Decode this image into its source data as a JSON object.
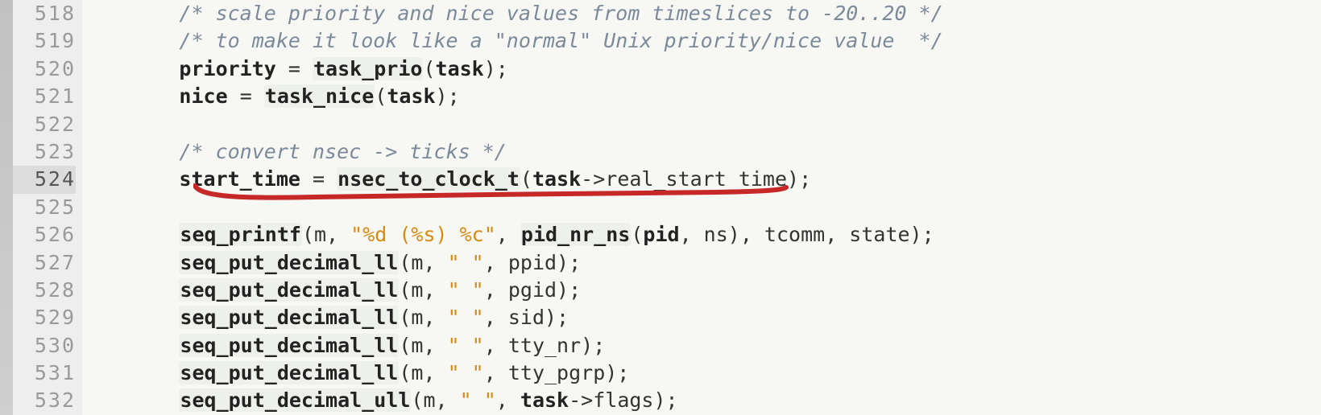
{
  "gutter": {
    "start": 518,
    "highlight": 524,
    "lines": [
      "518",
      "519",
      "520",
      "521",
      "522",
      "523",
      "524",
      "525",
      "526",
      "527",
      "528",
      "529",
      "530",
      "531",
      "532"
    ]
  },
  "indent": "        ",
  "code": {
    "l518": "/* scale priority and nice values from timeslices to -20..20 */",
    "l519": "/* to make it look like a \"normal\" Unix priority/nice value  */",
    "l520": {
      "a": "priority",
      "eq": " = ",
      "b": "task_prio",
      "c": "(",
      "d": "task",
      "e": ");"
    },
    "l521": {
      "a": "nice",
      "eq": " = ",
      "b": "task_nice",
      "c": "(",
      "d": "task",
      "e": ");"
    },
    "l522": "",
    "l523": "/* convert nsec -> ticks */",
    "l524": {
      "a": "start_time",
      "eq": " = ",
      "b": "nsec_to_clock_t",
      "c": "(",
      "d": "task",
      "arrow": "->",
      "e": "real_start_time",
      "f": ");"
    },
    "l525": "",
    "l526": {
      "a": "seq_printf",
      "b": "(m, ",
      "s": "\"%d (%s) %c\"",
      "c": ", ",
      "d": "pid_nr_ns",
      "e": "(",
      "f": "pid",
      "g": ", ns), tcomm, state);"
    },
    "l527": {
      "a": "seq_put_decimal_ll",
      "b": "(m, ",
      "s": "\" \"",
      "c": ", ppid);"
    },
    "l528": {
      "a": "seq_put_decimal_ll",
      "b": "(m, ",
      "s": "\" \"",
      "c": ", pgid);"
    },
    "l529": {
      "a": "seq_put_decimal_ll",
      "b": "(m, ",
      "s": "\" \"",
      "c": ", sid);"
    },
    "l530": {
      "a": "seq_put_decimal_ll",
      "b": "(m, ",
      "s": "\" \"",
      "c": ", tty_nr);"
    },
    "l531": {
      "a": "seq_put_decimal_ll",
      "b": "(m, ",
      "s": "\" \"",
      "c": ", tty_pgrp);"
    },
    "l532": {
      "a": "seq_put_decimal_ull",
      "b": "(m, ",
      "s": "\" \"",
      "c": ", ",
      "d": "task",
      "arrow": "->",
      "e": "flags);"
    }
  },
  "annotation": {
    "color": "#c62828"
  }
}
